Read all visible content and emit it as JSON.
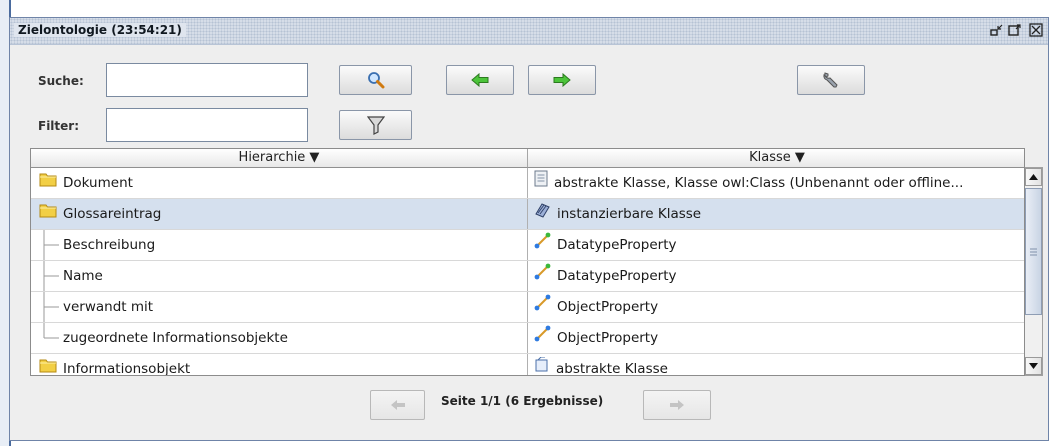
{
  "window": {
    "title": "Zielontologie (23:54:21)",
    "controls": {
      "minimize": "minimize-icon",
      "maximize": "maximize-icon",
      "close": "close-icon"
    }
  },
  "search": {
    "label": "Suche:",
    "value": ""
  },
  "filter": {
    "label": "Filter:",
    "value": ""
  },
  "toolbar": [
    "search-icon",
    "arrow-left-icon",
    "arrow-right-icon",
    "wrench-icon",
    "funnel-icon"
  ],
  "table": {
    "columns": [
      "Hierarchie ▼",
      "Klasse ▼"
    ],
    "rows": [
      {
        "name": "Dokument",
        "type": "abstrakte Klasse, Klasse owl:Class (Unbenannt oder offline...",
        "kind": "folder",
        "icon": "document-icon"
      },
      {
        "name": "Glossareintrag",
        "type": "instanzierbare Klasse",
        "kind": "folder",
        "icon": "pencil-book-icon",
        "selected": true
      },
      {
        "name": "Beschreibung",
        "type": "DatatypeProperty",
        "kind": "leaf",
        "icon": "datatype-property-icon"
      },
      {
        "name": "Name",
        "type": "DatatypeProperty",
        "kind": "leaf",
        "icon": "datatype-property-icon"
      },
      {
        "name": "verwandt mit",
        "type": "ObjectProperty",
        "kind": "leaf",
        "icon": "object-property-icon"
      },
      {
        "name": "zugeordnete Informationsobjekte",
        "type": "ObjectProperty",
        "kind": "leaf",
        "icon": "object-property-icon"
      },
      {
        "name": "Informationsobjekt",
        "type": "abstrakte Klasse",
        "kind": "folder",
        "icon": "abstract-class-icon"
      }
    ]
  },
  "pager": {
    "label": "Seite 1/1 (6 Ergebnisse)"
  },
  "colors": {
    "selection": "#d5e0ee",
    "titlebar": "#d6dde8",
    "accent_green": "#3caa2a"
  }
}
